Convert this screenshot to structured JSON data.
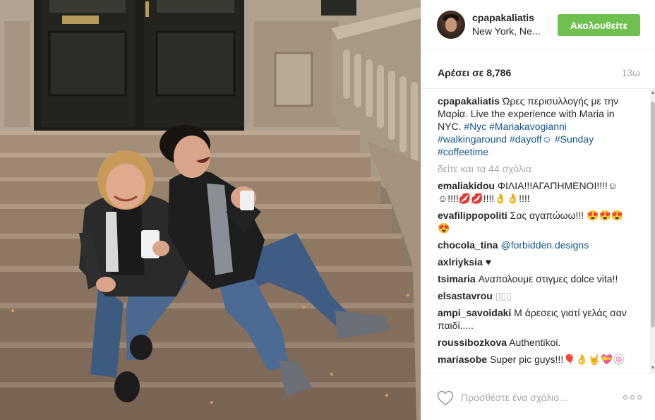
{
  "post": {
    "username": "cpapakaliatis",
    "location": "New York, Ne...",
    "follow_label": "Ακολουθείτε",
    "likes_text": "Αρέσει σε 8,786",
    "time_ago": "13ω"
  },
  "caption": {
    "username": "cpapakaliatis",
    "text": "Ώρες περισυλλογής με την Μαρία. Live the experience with Maria in NYC.",
    "tags": [
      "#Nyc",
      "#Mariakavogianni",
      "#walkingaround",
      "#dayoff☺",
      "#Sunday",
      "#coffeetime"
    ]
  },
  "view_all": "δείτε και τα 44 σχόλια",
  "comments": [
    {
      "user": "emaliakidou",
      "text": "ΦΙΛΙΑ!!!ΑΓΑΠΗΜΕΝΟΙ!!!!☺☺!!!!💋💋!!!!👌👌!!!!"
    },
    {
      "user": "evafilippopoliti",
      "text": "Σας αγαπώωω!!! 😍😍😍😍"
    },
    {
      "user": "chocola_tina",
      "text": "@forbidden.designs"
    },
    {
      "user": "axlriyksia",
      "text": "♥"
    },
    {
      "user": "tsimaria",
      "text": "Αναπολουμε στιγμες dolce vita!!"
    },
    {
      "user": "elsastavrou",
      "text": "▯▯▯"
    },
    {
      "user": "ampi_savoidaki",
      "text": "Μ άρεσεις γιατί γελάς σαν παιδί....."
    },
    {
      "user": "roussibozkova",
      "text": "Authentikoi."
    },
    {
      "user": "mariasobe",
      "text": "Super pic guys!!!🎈👌🤘💝🍥"
    }
  ],
  "add_comment": {
    "placeholder": "Προσθέστε ένα σχόλιο..."
  },
  "icons": {
    "like": "heart-outline-icon",
    "more": "more-options-icon"
  },
  "colors": {
    "follow_button": "#70c050",
    "hashtag": "#125688",
    "muted": "#a5a7aa",
    "text": "#262626"
  }
}
